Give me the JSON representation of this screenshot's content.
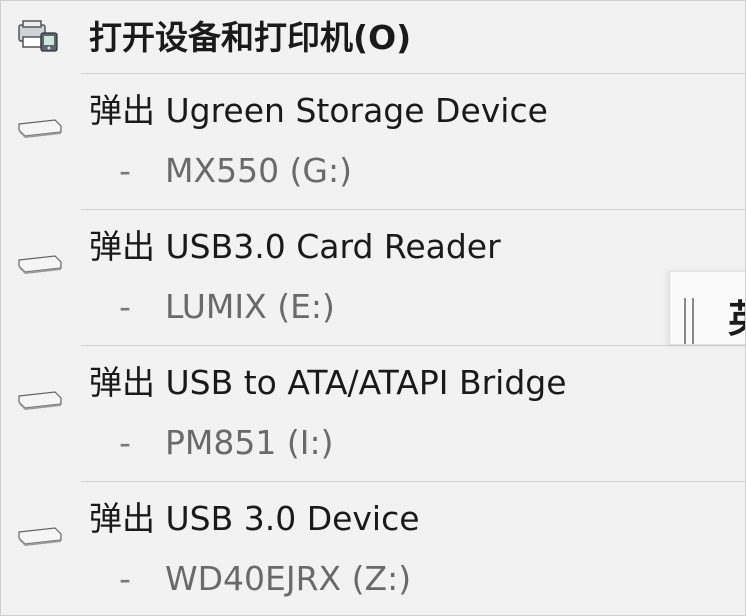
{
  "menu": {
    "open_devices": "打开设备和打印机(O)",
    "items": [
      {
        "eject_label": "弹出 Ugreen Storage Device",
        "dash": "-",
        "volume": "MX550 (G:)"
      },
      {
        "eject_label": "弹出 USB3.0 Card Reader",
        "dash": "-",
        "volume": "LUMIX (E:)"
      },
      {
        "eject_label": "弹出 USB to ATA/ATAPI Bridge",
        "dash": "-",
        "volume": "PM851 (I:)"
      },
      {
        "eject_label": "弹出 USB 3.0 Device",
        "dash": "-",
        "volume": "WD40EJRX (Z:)"
      }
    ],
    "icons": {
      "header": "devices-printers-icon",
      "drive": "usb-drive-icon"
    }
  },
  "side_panel": {
    "char": "英"
  }
}
